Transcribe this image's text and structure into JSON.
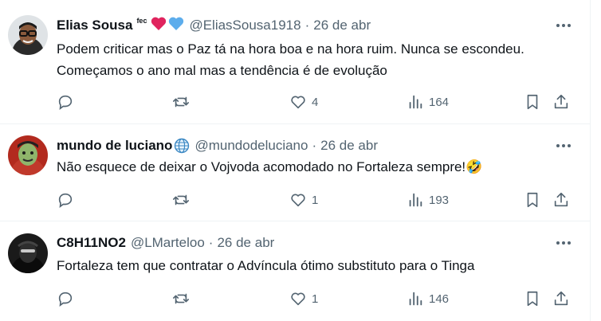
{
  "tweets": [
    {
      "name": "Elias Sousa",
      "badge": "fec",
      "emoji": "❤️💙",
      "handle": "@EliasSousa1918",
      "separator": "·",
      "date": "26 de abr",
      "text": "Podem criticar mas o Paz tá na hora boa e na hora ruim. Nunca se escondeu. Começamos o ano mal mas a tendência é de evolução",
      "replies": "",
      "retweets": "",
      "likes": "4",
      "views": "164"
    },
    {
      "name": "mundo de luciano",
      "emoji": "🌐",
      "handle": "@mundodeluciano",
      "separator": "·",
      "date": "26 de abr",
      "text": "Não esquece de deixar o Vojvoda acomodado no Fortaleza sempre!🤣",
      "replies": "",
      "retweets": "",
      "likes": "1",
      "views": "193"
    },
    {
      "name": "C8H11NO2",
      "handle": "@LMarteloo",
      "separator": "·",
      "date": "26 de abr",
      "text": "Fortaleza tem que contratar o Advíncula ótimo substituto para o Tinga",
      "replies": "",
      "retweets": "",
      "likes": "1",
      "views": "146"
    }
  ],
  "icons": {
    "reply": "reply-icon",
    "retweet": "retweet-icon",
    "like": "heart-icon",
    "views": "views-icon",
    "bookmark": "bookmark-icon",
    "share": "share-icon",
    "more": "more-icon"
  },
  "colors": {
    "text": "#0f1419",
    "secondary": "#536471",
    "divider": "#eff3f4",
    "heart": "#e0245e",
    "blue_heart": "#5dadec"
  }
}
